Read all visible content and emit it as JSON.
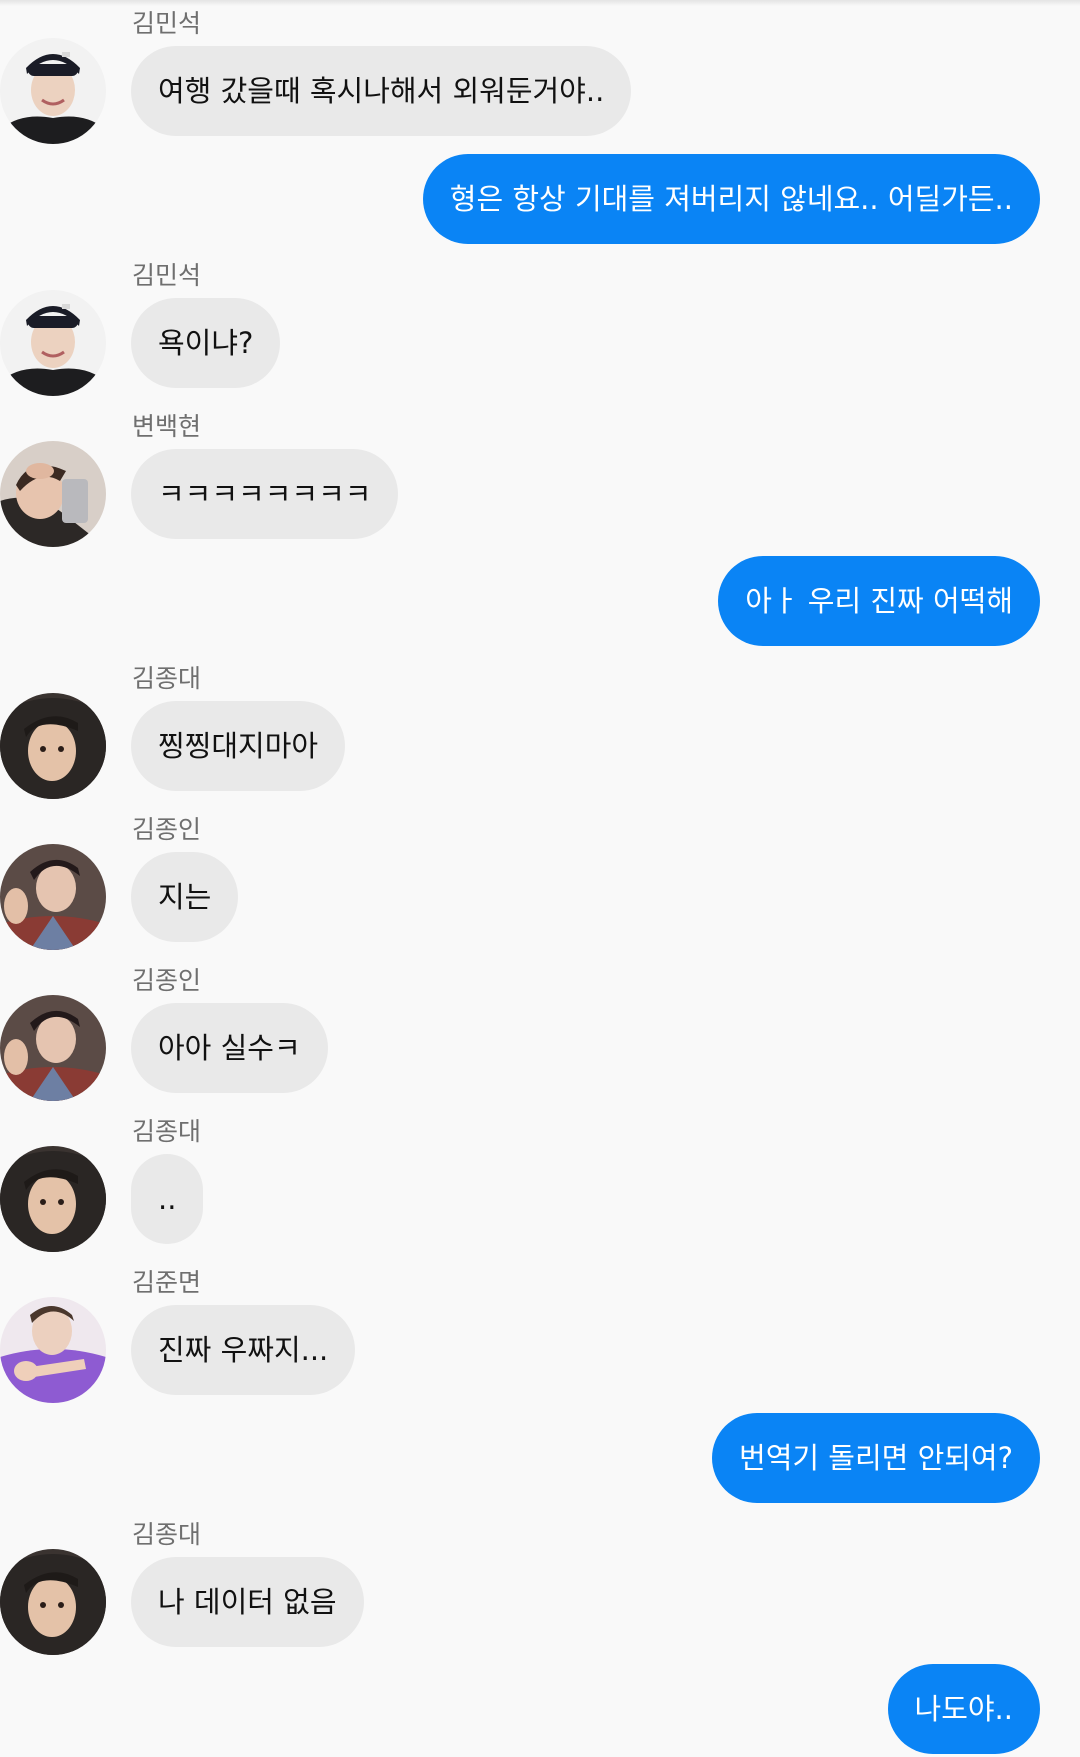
{
  "colors": {
    "background": "#f9f9f9",
    "incoming_bubble": "#e9e9e9",
    "outgoing_bubble": "#0a84f5",
    "sender_name": "#6f6f6f"
  },
  "messages": [
    {
      "direction": "incoming",
      "sender": "김민석",
      "avatar": "avatar-minseok",
      "text": "여행 갔을때 혹시나해서 외워둔거야.."
    },
    {
      "direction": "outgoing",
      "text": "형은 항상 기대를 져버리지 않네요.. 어딜가든.."
    },
    {
      "direction": "incoming",
      "sender": "김민석",
      "avatar": "avatar-minseok",
      "text": "욕이냐?"
    },
    {
      "direction": "incoming",
      "sender": "변백현",
      "avatar": "avatar-baekhyun",
      "text": "ㅋㅋㅋㅋㅋㅋㅋㅋ"
    },
    {
      "direction": "outgoing",
      "text": "아ㅏ 우리 진짜 어떡해"
    },
    {
      "direction": "incoming",
      "sender": "김종대",
      "avatar": "avatar-jongdae",
      "text": "찡찡대지마아"
    },
    {
      "direction": "incoming",
      "sender": "김종인",
      "avatar": "avatar-jongin",
      "text": "지는"
    },
    {
      "direction": "incoming",
      "sender": "김종인",
      "avatar": "avatar-jongin",
      "text": "아아 실수ㅋ"
    },
    {
      "direction": "incoming",
      "sender": "김종대",
      "avatar": "avatar-jongdae",
      "text": ".."
    },
    {
      "direction": "incoming",
      "sender": "김준면",
      "avatar": "avatar-junmyeon",
      "text": "진짜 우짜지..."
    },
    {
      "direction": "outgoing",
      "text": "번역기 돌리면 안되여?"
    },
    {
      "direction": "incoming",
      "sender": "김종대",
      "avatar": "avatar-jongdae",
      "text": "나 데이터 없음"
    },
    {
      "direction": "outgoing",
      "text": "나도야.."
    }
  ]
}
